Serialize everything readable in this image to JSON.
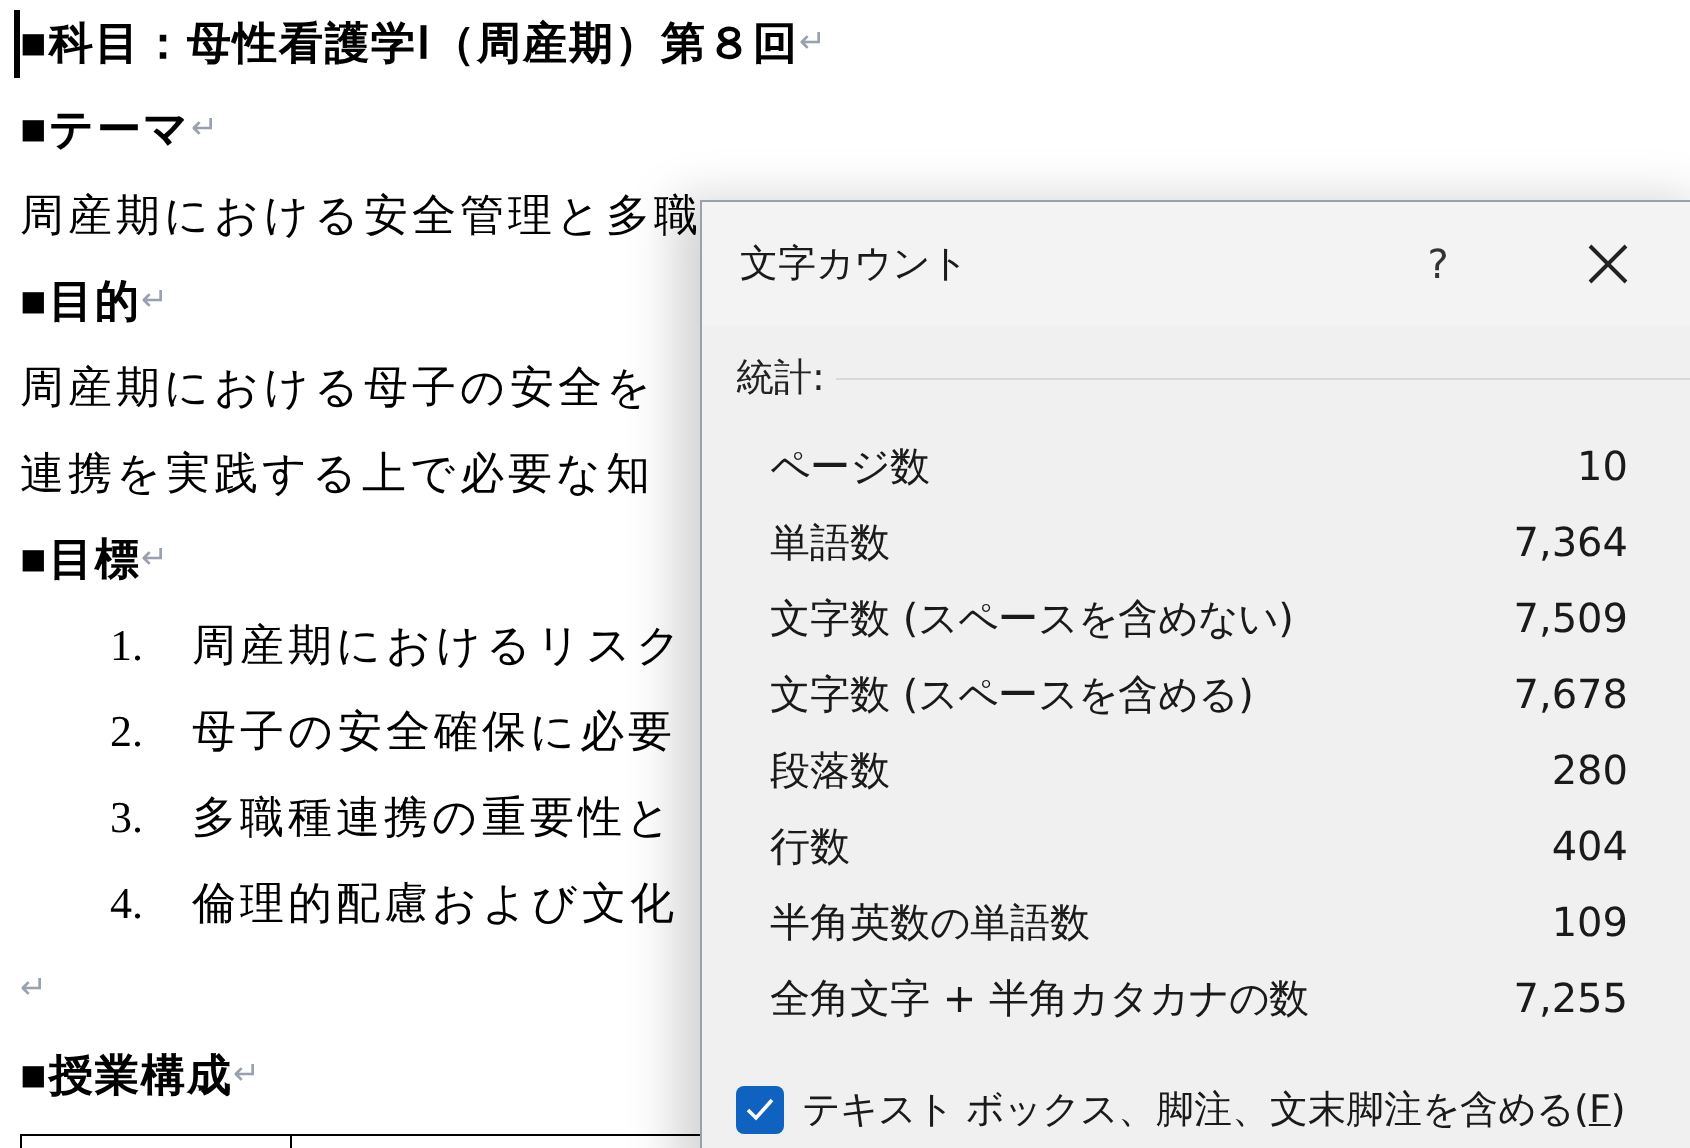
{
  "document": {
    "lines": [
      {
        "kind": "heading",
        "text": "■科目：母性看護学Ⅰ（周産期）第８回",
        "end_mark": "↵",
        "cursor": true
      },
      {
        "kind": "heading",
        "text": "■テーマ",
        "end_mark": "↵"
      },
      {
        "kind": "text",
        "text": "周産期における安全管理と多職"
      },
      {
        "kind": "heading",
        "text": "■目的",
        "end_mark": "↵"
      },
      {
        "kind": "text",
        "text": "周産期における母子の安全を"
      },
      {
        "kind": "text",
        "text": "連携を実践する上で必要な知"
      },
      {
        "kind": "heading",
        "text": "■目標",
        "end_mark": "↵"
      },
      {
        "kind": "item",
        "number": "1.",
        "text": "周産期におけるリスク"
      },
      {
        "kind": "item",
        "number": "2.",
        "text": "母子の安全確保に必要"
      },
      {
        "kind": "item",
        "number": "3.",
        "text": "多職種連携の重要性と"
      },
      {
        "kind": "item",
        "number": "4.",
        "text": "倫理的配慮および文化"
      },
      {
        "kind": "empty",
        "end_mark": "↵"
      },
      {
        "kind": "heading",
        "text": "■授業構成",
        "end_mark": "↵"
      },
      {
        "kind": "table"
      }
    ]
  },
  "dialog": {
    "title": "文字カウント",
    "help": "?",
    "section": "統計:",
    "stats": [
      {
        "label": "ページ数",
        "value": "10"
      },
      {
        "label": "単語数",
        "value": "7,364"
      },
      {
        "label": "文字数 (スペースを含めない)",
        "value": "7,509"
      },
      {
        "label": "文字数 (スペースを含める)",
        "value": "7,678"
      },
      {
        "label": "段落数",
        "value": "280"
      },
      {
        "label": "行数",
        "value": "404"
      },
      {
        "label": "半角英数の単語数",
        "value": "109"
      },
      {
        "label": "全角文字 + 半角カタカナの数",
        "value": "7,255"
      }
    ],
    "option": {
      "label_before": "テキスト ボックス、脚注、文末脚注を含める(",
      "access_key": "F",
      "label_after": ")",
      "checked": true
    }
  }
}
